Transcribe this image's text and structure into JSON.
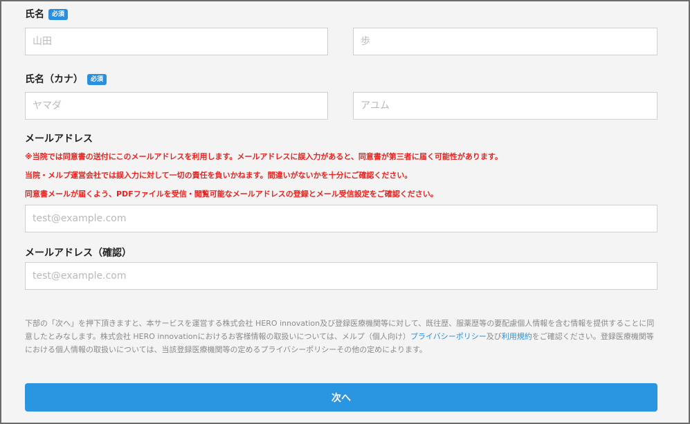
{
  "name": {
    "label": "氏名",
    "required_badge": "必須",
    "last_placeholder": "山田",
    "first_placeholder": "歩"
  },
  "name_kana": {
    "label": "氏名（カナ）",
    "required_badge": "必須",
    "last_placeholder": "ヤマダ",
    "first_placeholder": "アユム"
  },
  "email": {
    "label": "メールアドレス",
    "warnings": [
      "※当院では同意書の送付にこのメールアドレスを利用します。メールアドレスに誤入力があると、同意書が第三者に届く可能性があります。",
      "当院・メルプ運営会社では誤入力に対して一切の責任を負いかねます。間違いがないかを十分にご確認ください。",
      "同意書メールが届くよう、PDFファイルを受信・閲覧可能なメールアドレスの登録とメール受信設定をご確認ください。"
    ],
    "placeholder": "test@example.com"
  },
  "email_confirm": {
    "label": "メールアドレス（確認）",
    "placeholder": "test@example.com"
  },
  "notice": {
    "text_1": "下部の「次へ」を押下頂きますと、本サービスを運営する株式会社 HERO innovation及び登録医療機関等に対して、既往歴、服薬歴等の要配慮個人情報を含む情報を提供することに同意したとみなします。株式会社 HERO innovationにおけるお客様情報の取扱いについては、メルプ（個人向け）",
    "privacy_link": "プライバシーポリシー",
    "text_2": "及び",
    "terms_link": "利用規約",
    "text_3": "をご確認ください。登録医療機関等における個人情報の取扱いについては、当該登録医療機関等の定めるプライバシーポリシーその他の定めによります。"
  },
  "next_button": {
    "label": "次へ"
  },
  "colors": {
    "accent": "#2a96e2",
    "warning": "#e8231f",
    "badge": "#2a8fdd"
  }
}
